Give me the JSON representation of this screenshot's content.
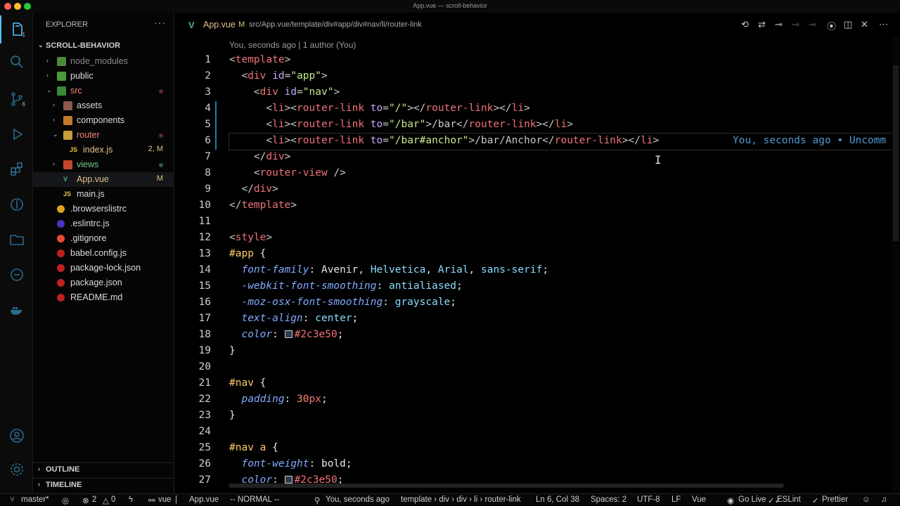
{
  "window": {
    "title": "App.vue — scroll-behavior"
  },
  "activity": {
    "scm_badge": "6",
    "explorer_badge": "1"
  },
  "sidebar": {
    "header": "EXPLORER",
    "more": "···",
    "project": "SCROLL-BEHAVIOR",
    "tree": [
      {
        "label": "node_modules",
        "depth": 1,
        "type": "folder",
        "chev": "›",
        "muted": true,
        "icon_color": "#4a8a3a"
      },
      {
        "label": "public",
        "depth": 1,
        "type": "folder",
        "chev": "›",
        "icon_color": "#4a9a3a"
      },
      {
        "label": "src",
        "depth": 1,
        "type": "folder",
        "chev": "⌄",
        "red": true,
        "icon_color": "#3a8a3a",
        "dot": true
      },
      {
        "label": "assets",
        "depth": 2,
        "type": "folder",
        "chev": "›",
        "icon_color": "#8a5a4a"
      },
      {
        "label": "components",
        "depth": 2,
        "type": "folder",
        "chev": "›",
        "icon_color": "#c57a2a"
      },
      {
        "label": "router",
        "depth": 2,
        "type": "folder",
        "chev": "⌄",
        "red": true,
        "icon_color": "#c79a3a",
        "dot": true
      },
      {
        "label": "index.js",
        "depth": 3,
        "type": "file",
        "yellow": true,
        "icon_text": "JS",
        "status": "2, M"
      },
      {
        "label": "views",
        "depth": 2,
        "type": "folder",
        "chev": "›",
        "green": true,
        "icon_color": "#c5462a",
        "dot_green": true
      },
      {
        "label": "App.vue",
        "depth": 2,
        "type": "file",
        "yellow": true,
        "icon_text": "V",
        "status": "M",
        "selected": true
      },
      {
        "label": "main.js",
        "depth": 2,
        "type": "file",
        "icon_text": "JS"
      },
      {
        "label": ".browserslistrc",
        "depth": 1,
        "type": "file",
        "icon_color": "#e0a020"
      },
      {
        "label": ".eslintrc.js",
        "depth": 1,
        "type": "file",
        "icon_color": "#4b32c3"
      },
      {
        "label": ".gitignore",
        "depth": 1,
        "type": "file",
        "icon_color": "#e84d31"
      },
      {
        "label": "babel.config.js",
        "depth": 1,
        "type": "file",
        "icon_color": "#c02020"
      },
      {
        "label": "package-lock.json",
        "depth": 1,
        "type": "file",
        "icon_color": "#c02020"
      },
      {
        "label": "package.json",
        "depth": 1,
        "type": "file",
        "icon_color": "#c02020"
      },
      {
        "label": "README.md",
        "depth": 1,
        "type": "file",
        "icon_color": "#c02020"
      }
    ],
    "outline": "OUTLINE",
    "timeline": "TIMELINE"
  },
  "tab": {
    "name": "App.vue",
    "modified": "M",
    "breadcrumbs": "src/App.vue/‹/›template/‹/›div#app/‹/›div#nav/‹/›li/‹/›router-link"
  },
  "editor": {
    "blame": "You, seconds ago | 1 author (You)",
    "inline_blame": "You, seconds ago • Uncomm",
    "current_line": 6,
    "lines": [
      {
        "n": "1"
      },
      {
        "n": "2"
      },
      {
        "n": "3"
      },
      {
        "n": "4"
      },
      {
        "n": "5"
      },
      {
        "n": "6"
      },
      {
        "n": "7"
      },
      {
        "n": "8"
      },
      {
        "n": "9"
      },
      {
        "n": "10"
      },
      {
        "n": "11"
      },
      {
        "n": "12"
      },
      {
        "n": "13"
      },
      {
        "n": "14"
      },
      {
        "n": "15"
      },
      {
        "n": "16"
      },
      {
        "n": "17"
      },
      {
        "n": "18"
      },
      {
        "n": "19"
      },
      {
        "n": "20"
      },
      {
        "n": "21"
      },
      {
        "n": "22"
      },
      {
        "n": "23"
      },
      {
        "n": "24"
      },
      {
        "n": "25"
      },
      {
        "n": "26"
      },
      {
        "n": "27"
      }
    ],
    "code": {
      "l1": [
        [
          "<",
          "br"
        ],
        [
          "template",
          "tag"
        ],
        [
          ">",
          "br"
        ]
      ],
      "l2": [
        [
          "  <",
          "br"
        ],
        [
          "div",
          "tag"
        ],
        [
          " id",
          "attr"
        ],
        [
          "=",
          "br"
        ],
        [
          "\"app\"",
          "str"
        ],
        [
          ">",
          "br"
        ]
      ],
      "l3": [
        [
          "    <",
          "br"
        ],
        [
          "div",
          "tag"
        ],
        [
          " id",
          "attr"
        ],
        [
          "=",
          "br"
        ],
        [
          "\"nav\"",
          "str"
        ],
        [
          ">",
          "br"
        ]
      ],
      "l4": [
        [
          "      <",
          "br"
        ],
        [
          "li",
          "tag"
        ],
        [
          "><",
          "br"
        ],
        [
          "router-link",
          "tag"
        ],
        [
          " to",
          "attr"
        ],
        [
          "=",
          "br"
        ],
        [
          "\"/\"",
          "str"
        ],
        [
          "></",
          "br"
        ],
        [
          "router-link",
          "tag"
        ],
        [
          "></",
          "br"
        ],
        [
          "li",
          "tag"
        ],
        [
          ">",
          "br"
        ]
      ],
      "l5": [
        [
          "      <",
          "br"
        ],
        [
          "li",
          "tag"
        ],
        [
          "><",
          "br"
        ],
        [
          "router-link",
          "tag"
        ],
        [
          " to",
          "attr"
        ],
        [
          "=",
          "br"
        ],
        [
          "\"/bar\"",
          "str"
        ],
        [
          ">/bar</",
          "br"
        ],
        [
          "router-link",
          "tag"
        ],
        [
          "></",
          "br"
        ],
        [
          "li",
          "tag"
        ],
        [
          ">",
          "br"
        ]
      ],
      "l6": [
        [
          "      <",
          "br"
        ],
        [
          "li",
          "tag"
        ],
        [
          "><",
          "br"
        ],
        [
          "router-link",
          "tag"
        ],
        [
          " to",
          "attr"
        ],
        [
          "=",
          "br"
        ],
        [
          "\"/bar#anchor\"",
          "str"
        ],
        [
          ">/bar/Anchor</",
          "br"
        ],
        [
          "router-link",
          "tag"
        ],
        [
          "></",
          "br"
        ],
        [
          "li",
          "tag"
        ],
        [
          ">",
          "br"
        ]
      ],
      "l7": [
        [
          "    </",
          "br"
        ],
        [
          "div",
          "tag"
        ],
        [
          ">",
          "br"
        ]
      ],
      "l8": [
        [
          "    <",
          "br"
        ],
        [
          "router-view",
          "tag"
        ],
        [
          " />",
          "br"
        ]
      ],
      "l9": [
        [
          "  </",
          "br"
        ],
        [
          "div",
          "tag"
        ],
        [
          ">",
          "br"
        ]
      ],
      "l10": [
        [
          "</",
          "br"
        ],
        [
          "template",
          "tag"
        ],
        [
          ">",
          "br"
        ]
      ],
      "l11": [],
      "l12": [
        [
          "<",
          "br"
        ],
        [
          "style",
          "tag"
        ],
        [
          ">",
          "br"
        ]
      ],
      "l13": [
        [
          "#app",
          "sel"
        ],
        [
          " {",
          "punc"
        ]
      ],
      "l14": [
        [
          "  font-family",
          "prop"
        ],
        [
          ": ",
          "punc"
        ],
        [
          "Avenir",
          "val"
        ],
        [
          ", ",
          "punc"
        ],
        [
          "Helvetica",
          "kw"
        ],
        [
          ", ",
          "punc"
        ],
        [
          "Arial",
          "kw"
        ],
        [
          ", ",
          "punc"
        ],
        [
          "sans-serif",
          "kw"
        ],
        [
          ";",
          "punc"
        ]
      ],
      "l15": [
        [
          "  -webkit-font-smoothing",
          "prop"
        ],
        [
          ": ",
          "punc"
        ],
        [
          "antialiased",
          "kw"
        ],
        [
          ";",
          "punc"
        ]
      ],
      "l16": [
        [
          "  -moz-osx-font-smoothing",
          "prop"
        ],
        [
          ": ",
          "punc"
        ],
        [
          "grayscale",
          "kw"
        ],
        [
          ";",
          "punc"
        ]
      ],
      "l17": [
        [
          "  text-align",
          "prop"
        ],
        [
          ": ",
          "punc"
        ],
        [
          "center",
          "kw"
        ],
        [
          ";",
          "punc"
        ]
      ],
      "l18": [
        [
          "  color",
          "prop"
        ],
        [
          ": ",
          "punc"
        ],
        [
          "SWATCH",
          "swatch"
        ],
        [
          "#2c3e50",
          "tag"
        ],
        [
          ";",
          "punc"
        ]
      ],
      "l19": [
        [
          "}",
          "punc"
        ]
      ],
      "l20": [],
      "l21": [
        [
          "#nav",
          "sel"
        ],
        [
          " {",
          "punc"
        ]
      ],
      "l22": [
        [
          "  padding",
          "prop"
        ],
        [
          ": ",
          "punc"
        ],
        [
          "30",
          "num"
        ],
        [
          "px",
          "tag"
        ],
        [
          ";",
          "punc"
        ]
      ],
      "l23": [
        [
          "}",
          "punc"
        ]
      ],
      "l24": [],
      "l25": [
        [
          "#nav a",
          "sel"
        ],
        [
          " {",
          "punc"
        ]
      ],
      "l26": [
        [
          "  font-weight",
          "prop"
        ],
        [
          ": ",
          "punc"
        ],
        [
          "bold",
          "val"
        ],
        [
          ";",
          "punc"
        ]
      ],
      "l27": [
        [
          "  color",
          "prop"
        ],
        [
          ": ",
          "punc"
        ],
        [
          "SWATCH",
          "swatch"
        ],
        [
          "#2c3e50",
          "tag"
        ],
        [
          ";",
          "punc"
        ]
      ]
    }
  },
  "status": {
    "branch": "master*",
    "errors": "2",
    "warnings": "0",
    "lang_crumb": "vue",
    "file": "App.vue",
    "mode": "-- NORMAL --",
    "blame": "You, seconds ago",
    "path": "template › div › div › li › router-link",
    "position": "Ln 6, Col 38",
    "spaces": "Spaces: 2",
    "encoding": "UTF-8",
    "eol": "LF",
    "language": "Vue",
    "golive": "Go Live",
    "eslint": "ESLint",
    "prettier": "Prettier"
  },
  "colors": {
    "accent": "#4fc1ff",
    "tag": "#f07178",
    "string": "#c3e88d",
    "selector": "#ffcb6b",
    "property": "#82aaff"
  }
}
